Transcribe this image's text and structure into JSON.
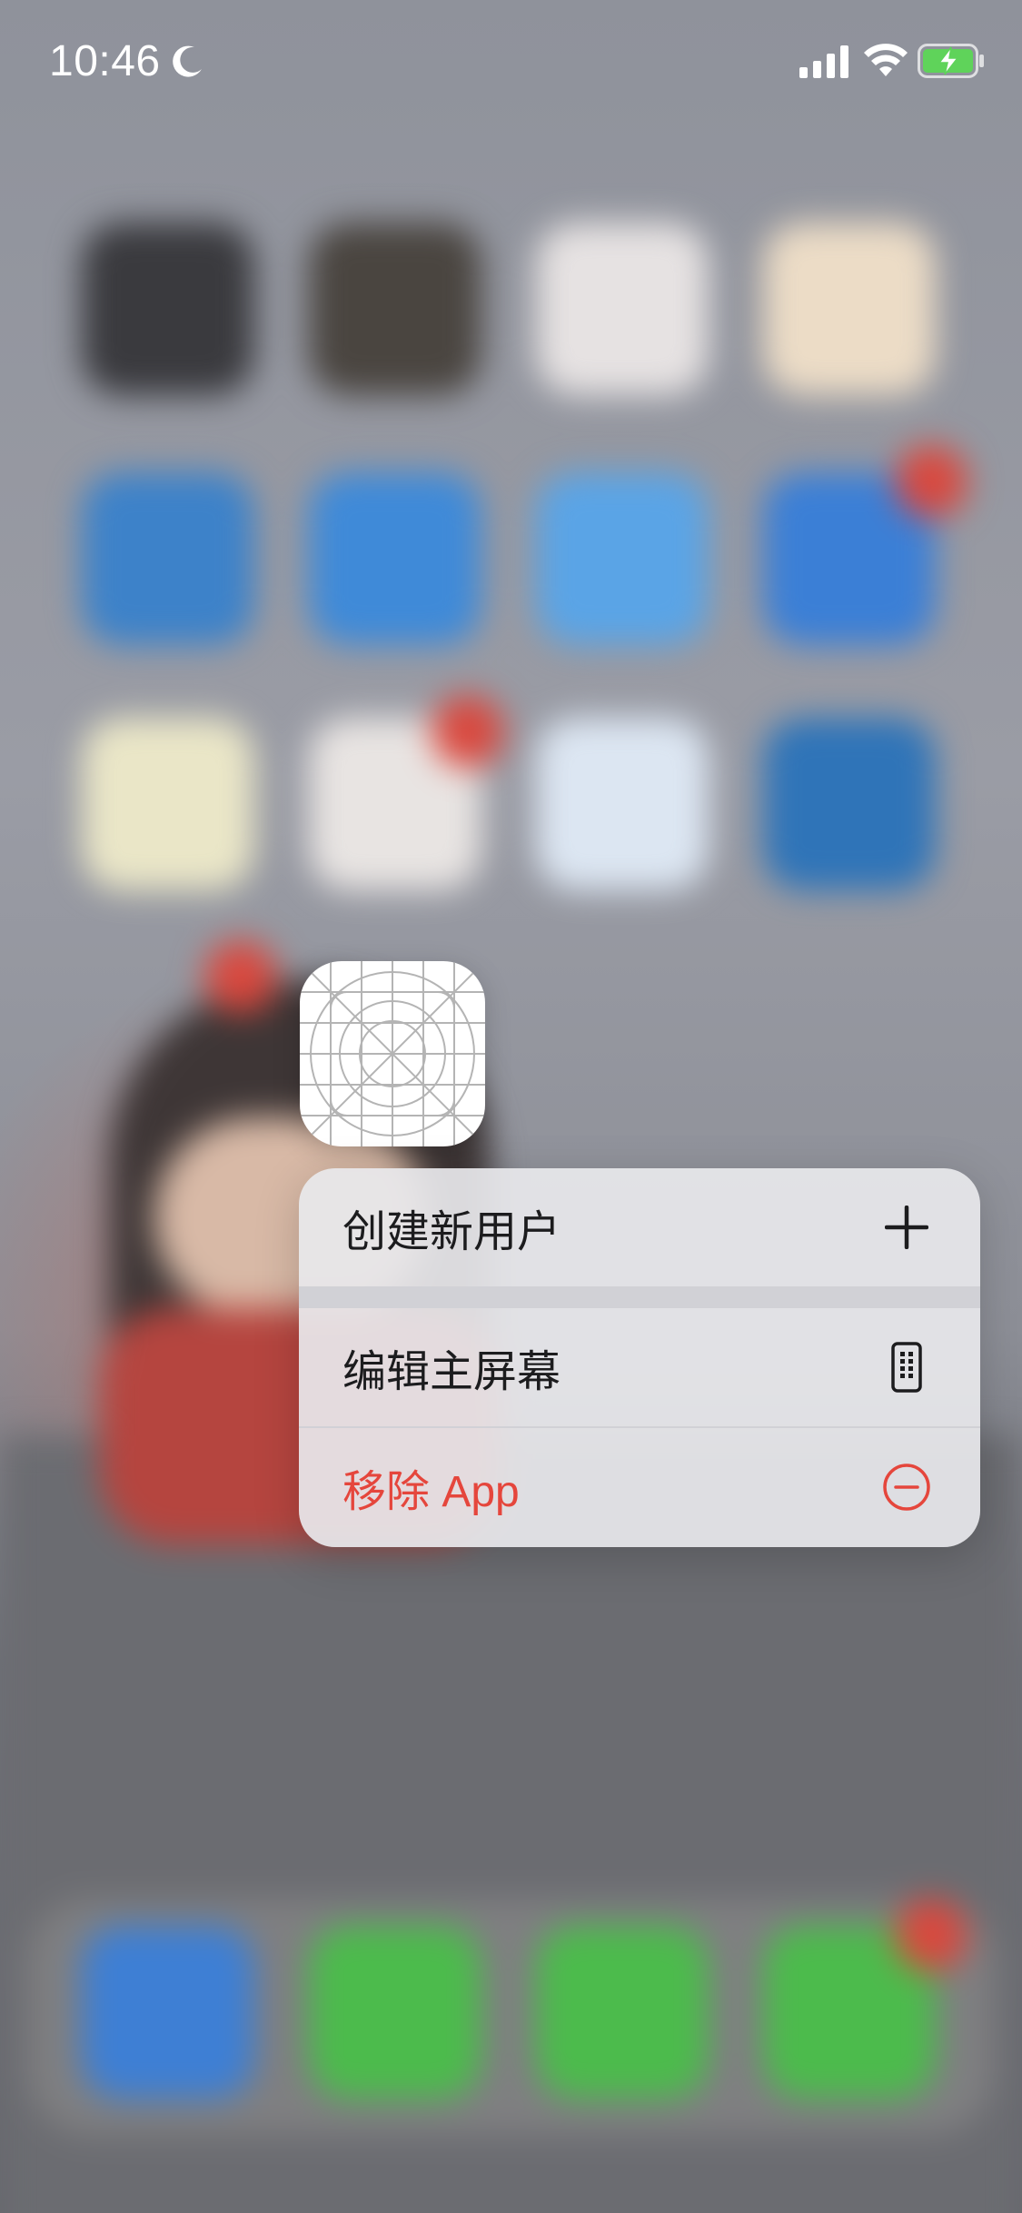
{
  "status_bar": {
    "time": "10:46",
    "icons": [
      "moon-icon",
      "cellular-signal-icon",
      "wifi-icon",
      "battery-charging-icon"
    ]
  },
  "focused_app": {
    "icon": "placeholder-app-icon"
  },
  "context_menu": {
    "items": [
      {
        "label": "创建新用户",
        "icon": "plus-icon",
        "destructive": false
      },
      {
        "label": "编辑主屏幕",
        "icon": "phone-screen-icon",
        "destructive": false
      },
      {
        "label": "移除 App",
        "icon": "minus-circle-icon",
        "destructive": true
      }
    ]
  },
  "colors": {
    "destructive": "#e5463c",
    "menu_background": "#e8e8ec",
    "battery_fill": "#5fd35a"
  }
}
